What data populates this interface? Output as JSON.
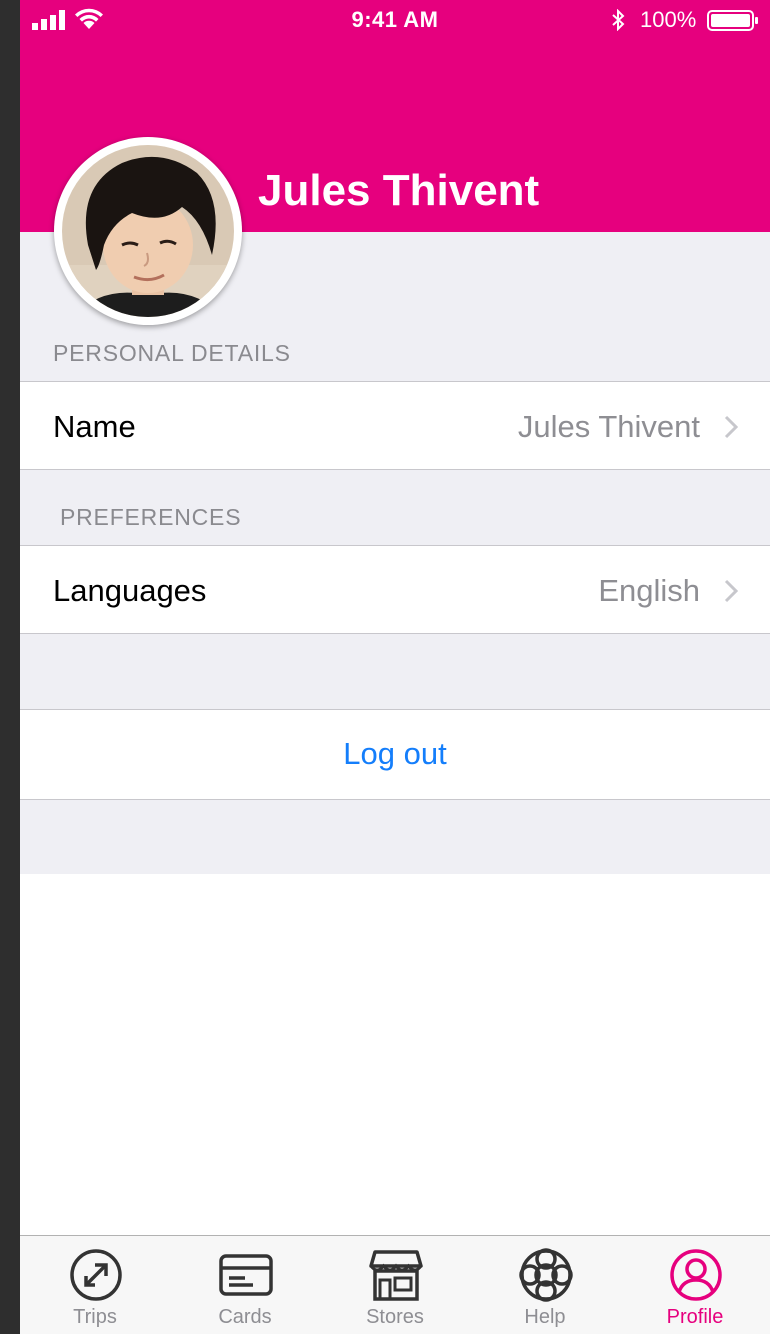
{
  "status_bar": {
    "time": "9:41 AM",
    "battery": "100%"
  },
  "header": {
    "name": "Jules Thivent",
    "background_color": "#e6007e"
  },
  "sections": {
    "personal": {
      "title": "PERSONAL DETAILS",
      "rows": [
        {
          "label": "Name",
          "value": "Jules Thivent"
        }
      ]
    },
    "preferences": {
      "title": "PREFERENCES",
      "rows": [
        {
          "label": "Languages",
          "value": "English"
        }
      ]
    }
  },
  "logout_label": "Log out",
  "tabbar": {
    "tabs": [
      {
        "label": "Trips",
        "icon": "trips-icon"
      },
      {
        "label": "Cards",
        "icon": "card-icon"
      },
      {
        "label": "Stores",
        "icon": "store-icon"
      },
      {
        "label": "Help",
        "icon": "lifebuoy-icon"
      },
      {
        "label": "Profile",
        "icon": "profile-icon",
        "active": true
      }
    ],
    "active_color": "#e6007e",
    "inactive_color": "#8e8e93"
  },
  "accent_color": "#147efb"
}
